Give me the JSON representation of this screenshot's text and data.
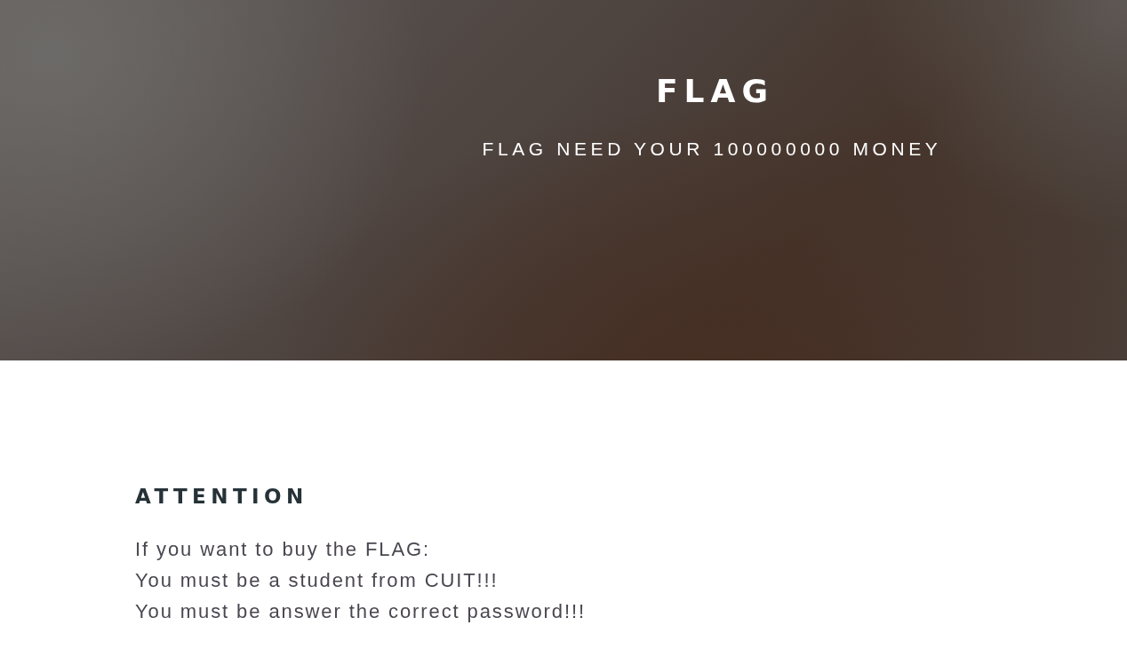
{
  "hero": {
    "title": "FLAG",
    "subtitle": "FLAG NEED YOUR 100000000 MONEY"
  },
  "attention": {
    "heading": "ATTENTION",
    "lines": [
      "If you want to buy the FLAG:",
      "You must be a student from CUIT!!!",
      "You must be answer the correct password!!!"
    ]
  }
}
